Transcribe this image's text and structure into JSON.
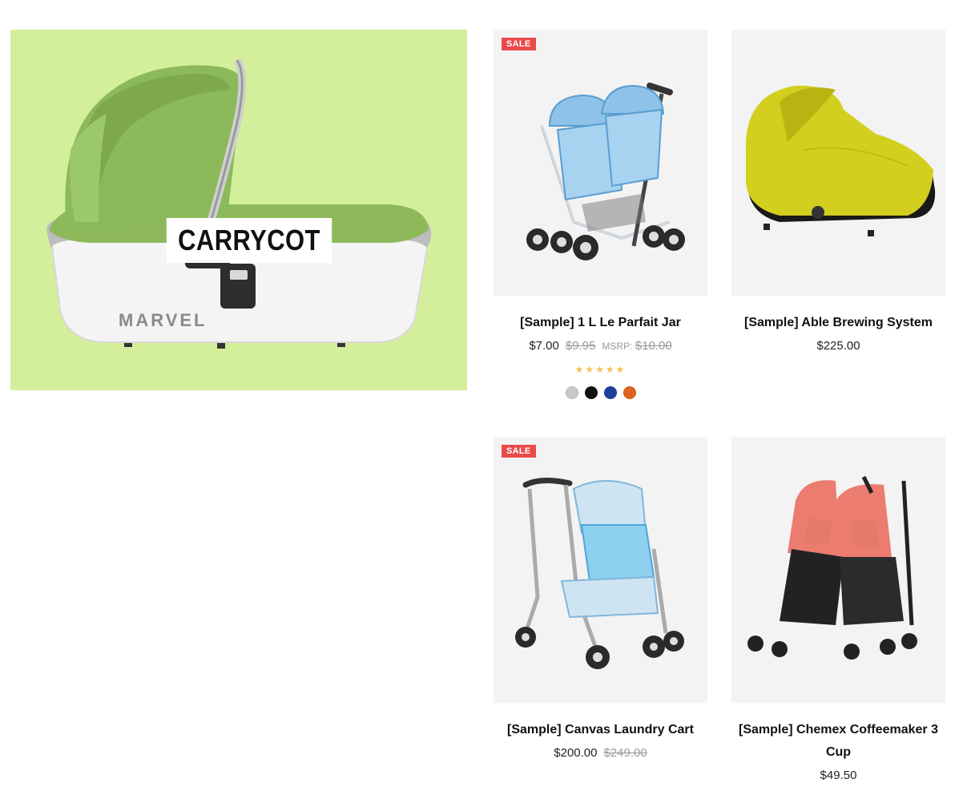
{
  "banner": {
    "label": "CARRYCOT",
    "brand": "MARVEL",
    "background": "#d3ef9c"
  },
  "products": [
    {
      "title": "[Sample] 1 L Le Parfait Jar",
      "badge": "SALE",
      "price": "$7.00",
      "was_price": "$9.95",
      "msrp_label": "MSRP:",
      "msrp_price": "$10.00",
      "rating": 5,
      "swatches": [
        "#c8c8c8",
        "#111111",
        "#1f3f99",
        "#e0621e"
      ]
    },
    {
      "title": "[Sample] Able Brewing System",
      "price": "$225.00"
    },
    {
      "title": "[Sample] Canvas Laundry Cart",
      "badge": "SALE",
      "price": "$200.00",
      "was_price": "$249.00"
    },
    {
      "title": "[Sample] Chemex Coffeemaker 3 Cup",
      "price": "$49.50"
    }
  ]
}
